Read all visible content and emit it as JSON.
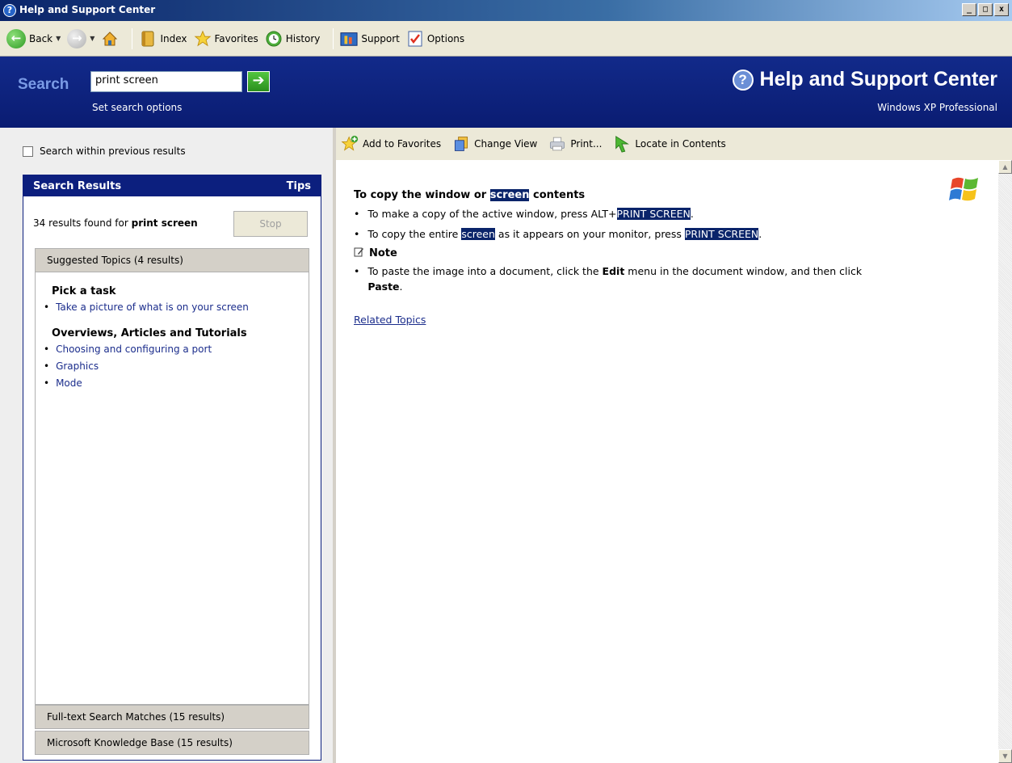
{
  "window": {
    "title": "Help and Support Center",
    "controls": {
      "minimize": "_",
      "maximize": "□",
      "close": "x"
    }
  },
  "toolbar": {
    "back": "Back",
    "index": "Index",
    "favorites": "Favorites",
    "history": "History",
    "support": "Support",
    "options": "Options"
  },
  "search": {
    "label": "Search",
    "value": "print screen",
    "options_link": "Set search options",
    "go_icon": "arrow-right-icon"
  },
  "header": {
    "title": "Help and Support Center",
    "edition": "Windows XP Professional"
  },
  "left": {
    "within_previous": "Search within previous results",
    "panel_title": "Search Results",
    "tips": "Tips",
    "count_prefix": "34 results found for",
    "count_query": "print screen",
    "stop": "Stop",
    "suggested_head": "Suggested Topics (4 results)",
    "groups": [
      {
        "title": "Pick a task",
        "items": [
          "Take a picture of what is on your screen"
        ]
      },
      {
        "title": "Overviews, Articles and Tutorials",
        "items": [
          "Choosing and configuring a port",
          "Graphics",
          "Mode"
        ]
      }
    ],
    "fulltext_head": "Full-text Search Matches (15 results)",
    "kb_head": "Microsoft Knowledge Base (15 results)"
  },
  "right_toolbar": {
    "add_favorites": "Add to Favorites",
    "change_view": "Change View",
    "print": "Print...",
    "locate": "Locate in Contents"
  },
  "article": {
    "heading_pre": "To copy the window or",
    "heading_hl": "screen",
    "heading_post": "contents",
    "b1_pre": "To make a copy of the active window, press ALT+",
    "b1_hl": "PRINT SCREEN",
    "b1_post": ".",
    "b2_pre": "To copy the entire",
    "b2_hl1": "screen",
    "b2_mid": "as it appears on your monitor, press",
    "b2_hl2": "PRINT SCREEN",
    "b2_post": ".",
    "note_label": "Note",
    "note_pre": "To paste the image into a document, click the",
    "note_edit": "Edit",
    "note_mid": "menu in the document window, and then click",
    "note_paste": "Paste",
    "note_post": ".",
    "related": "Related Topics"
  },
  "colors": {
    "header_blue": "#0c1f7e",
    "highlight": "#0a246a",
    "link": "#1b2d8c"
  }
}
